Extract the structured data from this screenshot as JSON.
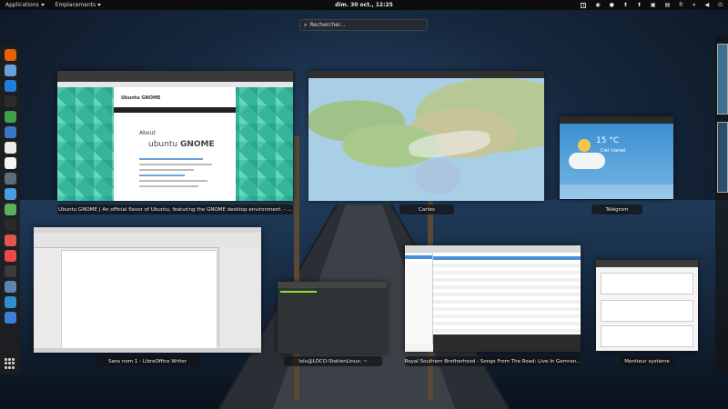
{
  "topbar": {
    "applications": "Applications",
    "places": "Emplacements",
    "clock": "dim. 30 oct., 12:25",
    "workspace_indicator": "1",
    "language": "fr",
    "status_icons": [
      "eye-icon",
      "microphone-icon",
      "arrow-up-icon",
      "arrow-up-icon",
      "clipboard-icon",
      "window-icon",
      "network-icon",
      "volume-icon",
      "power-icon"
    ]
  },
  "search": {
    "placeholder": "Rechercher..."
  },
  "dash": {
    "apps": [
      {
        "name": "firefox",
        "color": "#e66000"
      },
      {
        "name": "chromium",
        "color": "#6aa0d8"
      },
      {
        "name": "browser-globe",
        "color": "#1e7ed9"
      },
      {
        "name": "terminal",
        "color": "#2b2b2b"
      },
      {
        "name": "cube",
        "color": "#3ca24a"
      },
      {
        "name": "calendar",
        "color": "#3b77c9"
      },
      {
        "name": "files",
        "color": "#ececec"
      },
      {
        "name": "text-editor",
        "color": "#f4f4f4"
      },
      {
        "name": "disk",
        "color": "#5b6c7c"
      },
      {
        "name": "weather",
        "color": "#4a9ee0"
      },
      {
        "name": "image-viewer",
        "color": "#5dae5b"
      },
      {
        "name": "system-monitor",
        "color": "#2b2b2b"
      },
      {
        "name": "software-center",
        "color": "#e0584a"
      },
      {
        "name": "music",
        "color": "#e84848"
      },
      {
        "name": "disk-usage",
        "color": "#3b3b3b"
      },
      {
        "name": "settings-circle",
        "color": "#5b84b0"
      },
      {
        "name": "gear",
        "color": "#2f8fd0"
      },
      {
        "name": "document",
        "color": "#3d7ed8"
      }
    ]
  },
  "windows": {
    "ubuntu_gnome": {
      "caption": "Ubuntu GNOME | An official flavor of Ubuntu, featuring the GNOME desktop environment. - ...",
      "page_title": "Ubuntu GNOME",
      "about": "About",
      "logo_light": "ubuntu",
      "logo_bold": "GNOME"
    },
    "maps": {
      "caption": "Cartes"
    },
    "telegrom": {
      "caption": "Télégrom",
      "temperature": "15 °C",
      "condition": "Ciel claireé"
    },
    "writer": {
      "caption": "Sans nom 1 - LibreOffice Writer"
    },
    "terminal": {
      "caption": "lolu@LOCO-StationLinux: ~"
    },
    "music": {
      "caption": "Royal Southern Brotherhood - Songs From The Road: Live In Gemran..."
    },
    "monitor": {
      "caption": "Moniteur système"
    }
  }
}
